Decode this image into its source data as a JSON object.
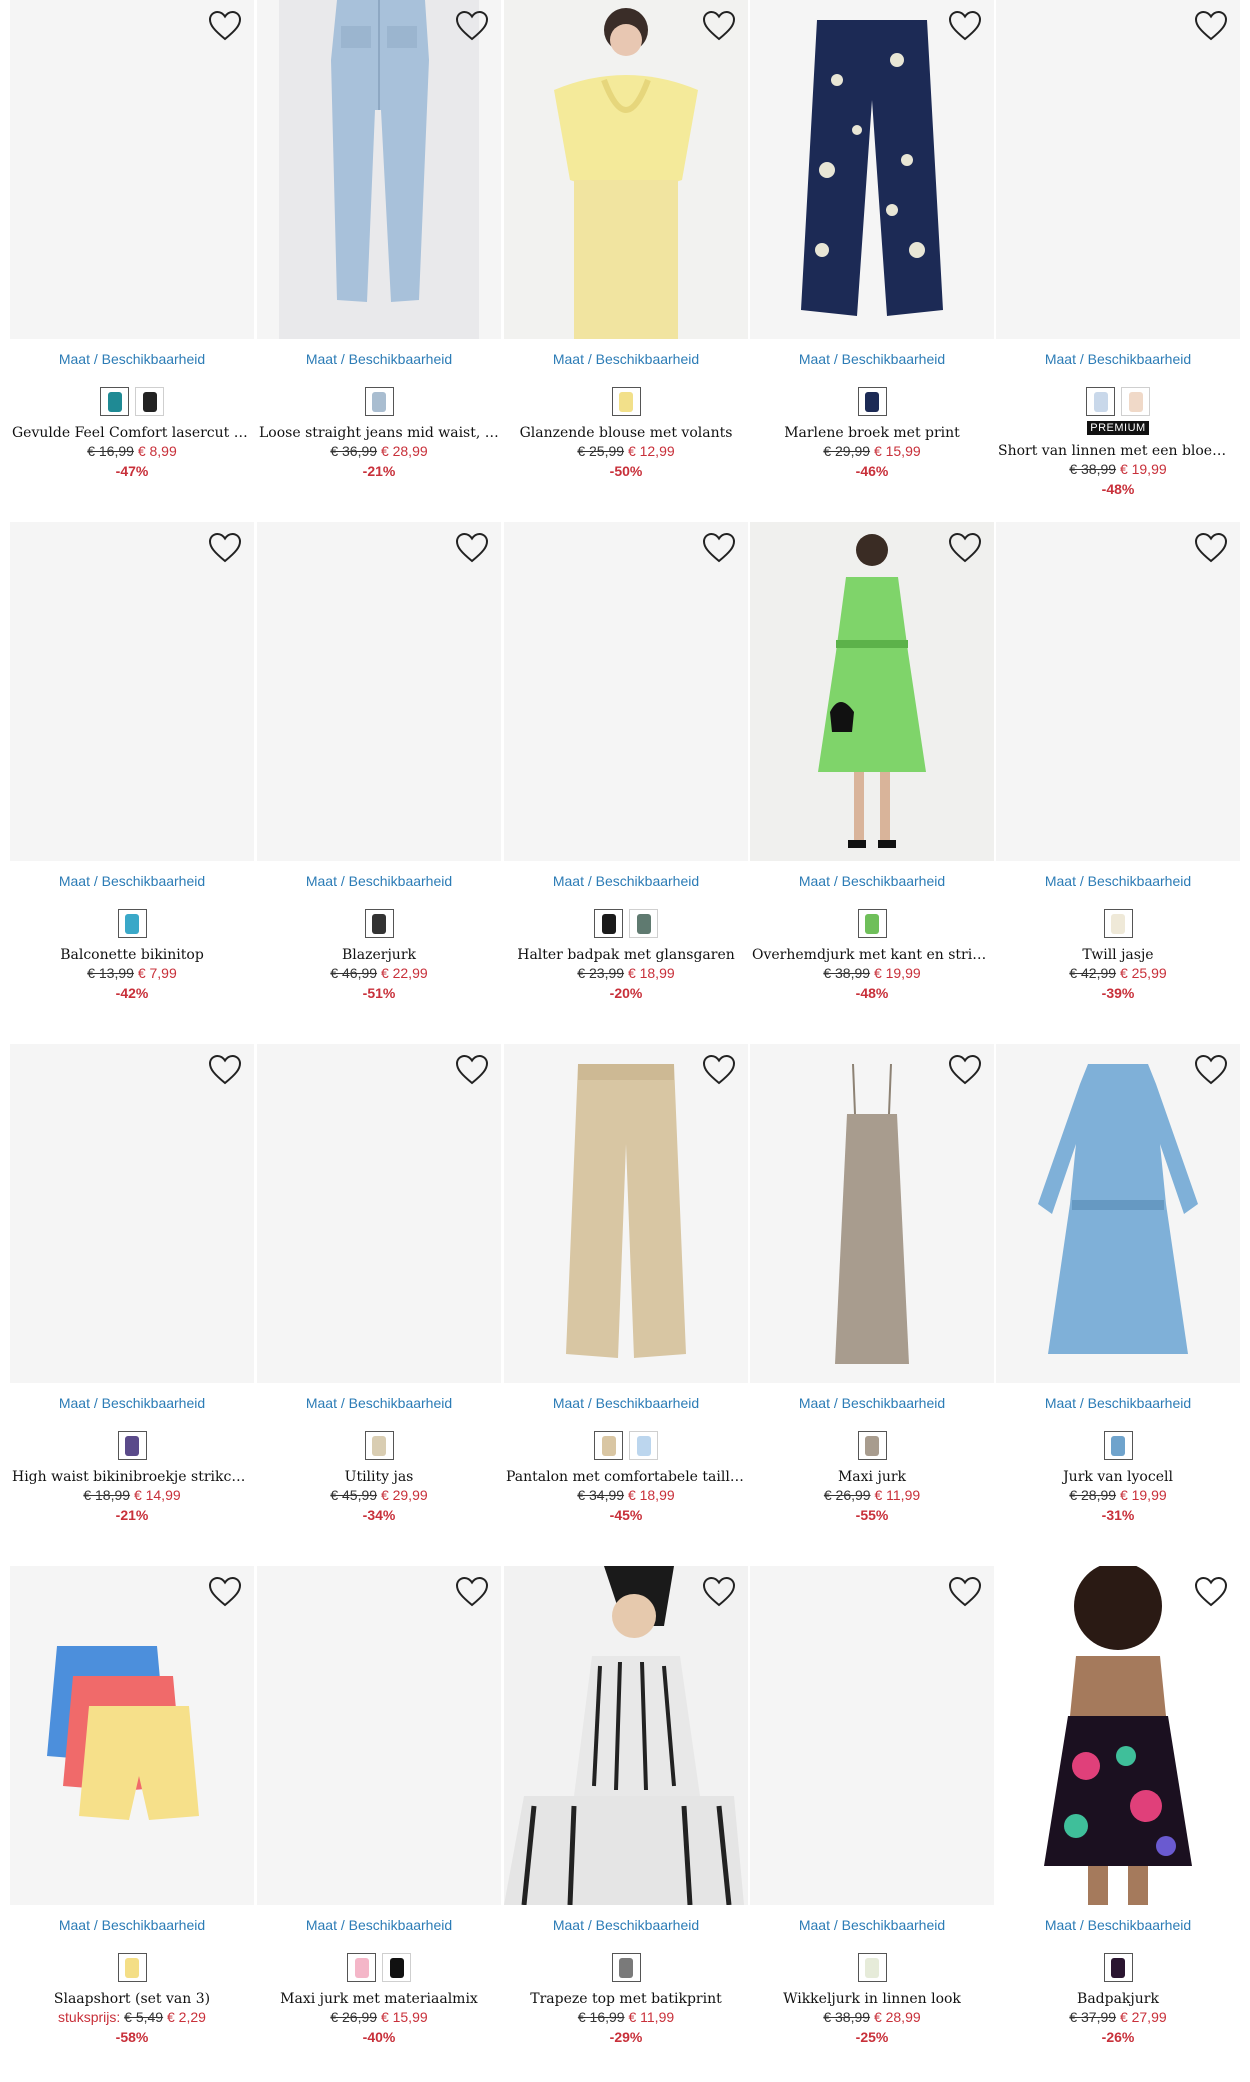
{
  "availability_label": "Maat / Beschikbaarheid",
  "colors": {
    "accent_blue": "#2c7cb6",
    "sale_red": "#c8303a",
    "image_bg": "#f5f5f5"
  },
  "products": [
    {
      "title": "Gevulde Feel Comfort lasercut T-sh...",
      "old_price": "€ 16,99",
      "new_price": "€ 8,99",
      "discount": "-47%",
      "swatches": [
        "#1f8a94",
        "#222222"
      ],
      "image": "empty"
    },
    {
      "title": "Loose straight jeans mid waist, low ...",
      "old_price": "€ 36,99",
      "new_price": "€ 28,99",
      "discount": "-21%",
      "swatches": [
        "#a9bdd0"
      ],
      "image": "jeans"
    },
    {
      "title": "Glanzende blouse met volants",
      "old_price": "€ 25,99",
      "new_price": "€ 12,99",
      "discount": "-50%",
      "swatches": [
        "#f2e08a"
      ],
      "image": "blouse"
    },
    {
      "title": "Marlene broek met print",
      "old_price": "€ 29,99",
      "new_price": "€ 15,99",
      "discount": "-46%",
      "swatches": [
        "#1c2a55"
      ],
      "image": "pants-print"
    },
    {
      "title": "Short van linnen met een bloemenp...",
      "old_price": "€ 38,99",
      "new_price": "€ 19,99",
      "discount": "-48%",
      "swatches": [
        "#c9d8ea",
        "#f0d9c8"
      ],
      "badge": "PREMIUM",
      "image": "empty"
    },
    {
      "title": "Balconette bikinitop",
      "old_price": "€ 13,99",
      "new_price": "€ 7,99",
      "discount": "-42%",
      "swatches": [
        "#3aa8c8"
      ],
      "image": "empty"
    },
    {
      "title": "Blazerjurk",
      "old_price": "€ 46,99",
      "new_price": "€ 22,99",
      "discount": "-51%",
      "swatches": [
        "#333333"
      ],
      "image": "empty"
    },
    {
      "title": "Halter badpak met glansgaren",
      "old_price": "€ 23,99",
      "new_price": "€ 18,99",
      "discount": "-20%",
      "swatches": [
        "#1a1a1a",
        "#5f7a70"
      ],
      "image": "empty"
    },
    {
      "title": "Overhemdjurk met kant en strikcei...",
      "old_price": "€ 38,99",
      "new_price": "€ 19,99",
      "discount": "-48%",
      "swatches": [
        "#6fbf5a"
      ],
      "image": "green-dress"
    },
    {
      "title": "Twill jasje",
      "old_price": "€ 42,99",
      "new_price": "€ 25,99",
      "discount": "-39%",
      "swatches": [
        "#efe9d8"
      ],
      "image": "empty"
    },
    {
      "title": "High waist bikinibroekje strikceint...",
      "old_price": "€ 18,99",
      "new_price": "€ 14,99",
      "discount": "-21%",
      "swatches": [
        "#5a4a8a"
      ],
      "image": "empty"
    },
    {
      "title": "Utility jas",
      "old_price": "€ 45,99",
      "new_price": "€ 29,99",
      "discount": "-34%",
      "swatches": [
        "#d9cdb2"
      ],
      "image": "empty"
    },
    {
      "title": "Pantalon met comfortabele tailleb...",
      "old_price": "€ 34,99",
      "new_price": "€ 18,99",
      "discount": "-45%",
      "swatches": [
        "#d9c6a3",
        "#bcd6ee"
      ],
      "image": "beige-pants"
    },
    {
      "title": "Maxi jurk",
      "old_price": "€ 26,99",
      "new_price": "€ 11,99",
      "discount": "-55%",
      "swatches": [
        "#a89c8e"
      ],
      "image": "maxi"
    },
    {
      "title": "Jurk van lyocell",
      "old_price": "€ 28,99",
      "new_price": "€ 19,99",
      "discount": "-31%",
      "swatches": [
        "#6fa3cc"
      ],
      "image": "denim-dress"
    },
    {
      "title": "Slaapshort (set van 3)",
      "unit_label": "stuksprijs:",
      "old_price": "€ 5,49",
      "new_price": "€ 2,29",
      "discount": "-58%",
      "swatches": [
        "#f4de86"
      ],
      "image": "shorts"
    },
    {
      "title": "Maxi jurk met materiaalmix",
      "old_price": "€ 26,99",
      "new_price": "€ 15,99",
      "discount": "-40%",
      "swatches": [
        "#f4b6c8",
        "#111111"
      ],
      "image": "empty"
    },
    {
      "title": "Trapeze top met batikprint",
      "old_price": "€ 16,99",
      "new_price": "€ 11,99",
      "discount": "-29%",
      "swatches": [
        "#7a7a7a"
      ],
      "image": "batik"
    },
    {
      "title": "Wikkeljurk in linnen look",
      "old_price": "€ 38,99",
      "new_price": "€ 28,99",
      "discount": "-25%",
      "swatches": [
        "#e6ebd9"
      ],
      "image": "empty"
    },
    {
      "title": "Badpakjurk",
      "old_price": "€ 37,99",
      "new_price": "€ 27,99",
      "discount": "-26%",
      "swatches": [
        "#2a1530"
      ],
      "image": "swimdress"
    }
  ]
}
